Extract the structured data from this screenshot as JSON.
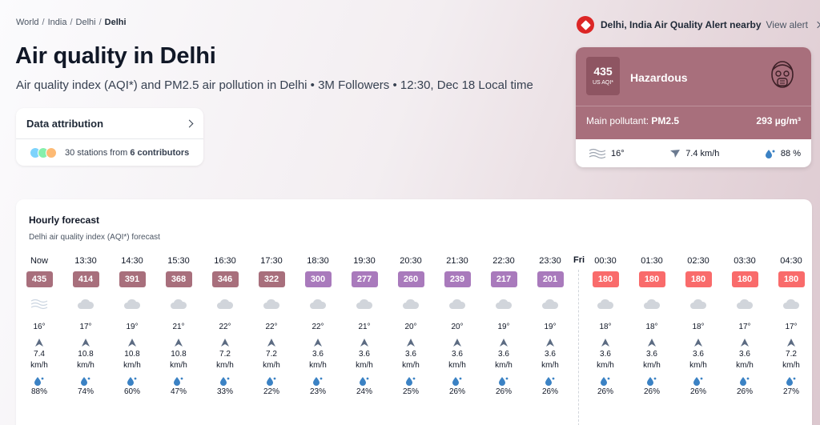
{
  "breadcrumb": {
    "items": [
      "World",
      "India",
      "Delhi"
    ],
    "current": "Delhi"
  },
  "page": {
    "title": "Air quality in Delhi",
    "subtitle": "Air quality index (AQI*) and PM2.5 air pollution in Delhi • 3M Followers • 12:30, Dec 18 Local time"
  },
  "attribution": {
    "title": "Data attribution",
    "stations_text": "30 stations from",
    "contributors_text": "6 contributors"
  },
  "alert": {
    "text": "Delhi, India Air Quality Alert nearby",
    "link": "View alert"
  },
  "current": {
    "aqi": "435",
    "aqi_unit": "US AQI*",
    "level": "Hazardous",
    "pollutant_label": "Main pollutant:",
    "pollutant": "PM2.5",
    "concentration": "293 µg/m³",
    "temp": "16°",
    "wind": "7.4 km/h",
    "humidity": "88 %",
    "colors": {
      "card": "#a86f7c",
      "box": "#8e5562"
    }
  },
  "forecast": {
    "title": "Hourly forecast",
    "subtitle": "Delhi air quality index (AQI*) forecast",
    "day_label": "Fri",
    "wind_unit": "km/h",
    "colors": {
      "hazardous": "#a86f7c",
      "very_unhealthy": "#a97abc",
      "unhealthy": "#f96b6b"
    },
    "hours": [
      {
        "time": "Now",
        "aqi": "435",
        "level": "hazardous",
        "icon": "haze-icon",
        "temp": "16°",
        "wind": "7.4",
        "hum": "88%"
      },
      {
        "time": "13:30",
        "aqi": "414",
        "level": "hazardous",
        "icon": "cloud-icon",
        "temp": "17°",
        "wind": "10.8",
        "hum": "74%"
      },
      {
        "time": "14:30",
        "aqi": "391",
        "level": "hazardous",
        "icon": "cloud-icon",
        "temp": "19°",
        "wind": "10.8",
        "hum": "60%"
      },
      {
        "time": "15:30",
        "aqi": "368",
        "level": "hazardous",
        "icon": "cloud-icon",
        "temp": "21°",
        "wind": "10.8",
        "hum": "47%"
      },
      {
        "time": "16:30",
        "aqi": "346",
        "level": "hazardous",
        "icon": "cloud-icon",
        "temp": "22°",
        "wind": "7.2",
        "hum": "33%"
      },
      {
        "time": "17:30",
        "aqi": "322",
        "level": "hazardous",
        "icon": "cloud-icon",
        "temp": "22°",
        "wind": "7.2",
        "hum": "22%"
      },
      {
        "time": "18:30",
        "aqi": "300",
        "level": "very_unhealthy",
        "icon": "cloud-icon",
        "temp": "22°",
        "wind": "3.6",
        "hum": "23%"
      },
      {
        "time": "19:30",
        "aqi": "277",
        "level": "very_unhealthy",
        "icon": "cloud-icon",
        "temp": "21°",
        "wind": "3.6",
        "hum": "24%"
      },
      {
        "time": "20:30",
        "aqi": "260",
        "level": "very_unhealthy",
        "icon": "cloud-icon",
        "temp": "20°",
        "wind": "3.6",
        "hum": "25%"
      },
      {
        "time": "21:30",
        "aqi": "239",
        "level": "very_unhealthy",
        "icon": "cloud-icon",
        "temp": "20°",
        "wind": "3.6",
        "hum": "26%"
      },
      {
        "time": "22:30",
        "aqi": "217",
        "level": "very_unhealthy",
        "icon": "cloud-icon",
        "temp": "19°",
        "wind": "3.6",
        "hum": "26%"
      },
      {
        "time": "23:30",
        "aqi": "201",
        "level": "very_unhealthy",
        "icon": "cloud-icon",
        "temp": "19°",
        "wind": "3.6",
        "hum": "26%"
      },
      {
        "time": "00:30",
        "aqi": "180",
        "level": "unhealthy",
        "icon": "cloud-icon",
        "temp": "18°",
        "wind": "3.6",
        "hum": "26%"
      },
      {
        "time": "01:30",
        "aqi": "180",
        "level": "unhealthy",
        "icon": "cloud-icon",
        "temp": "18°",
        "wind": "3.6",
        "hum": "26%"
      },
      {
        "time": "02:30",
        "aqi": "180",
        "level": "unhealthy",
        "icon": "cloud-icon",
        "temp": "18°",
        "wind": "3.6",
        "hum": "26%"
      },
      {
        "time": "03:30",
        "aqi": "180",
        "level": "unhealthy",
        "icon": "cloud-icon",
        "temp": "17°",
        "wind": "3.6",
        "hum": "26%"
      },
      {
        "time": "04:30",
        "aqi": "180",
        "level": "unhealthy",
        "icon": "cloud-icon",
        "temp": "17°",
        "wind": "7.2",
        "hum": "27%"
      }
    ]
  }
}
